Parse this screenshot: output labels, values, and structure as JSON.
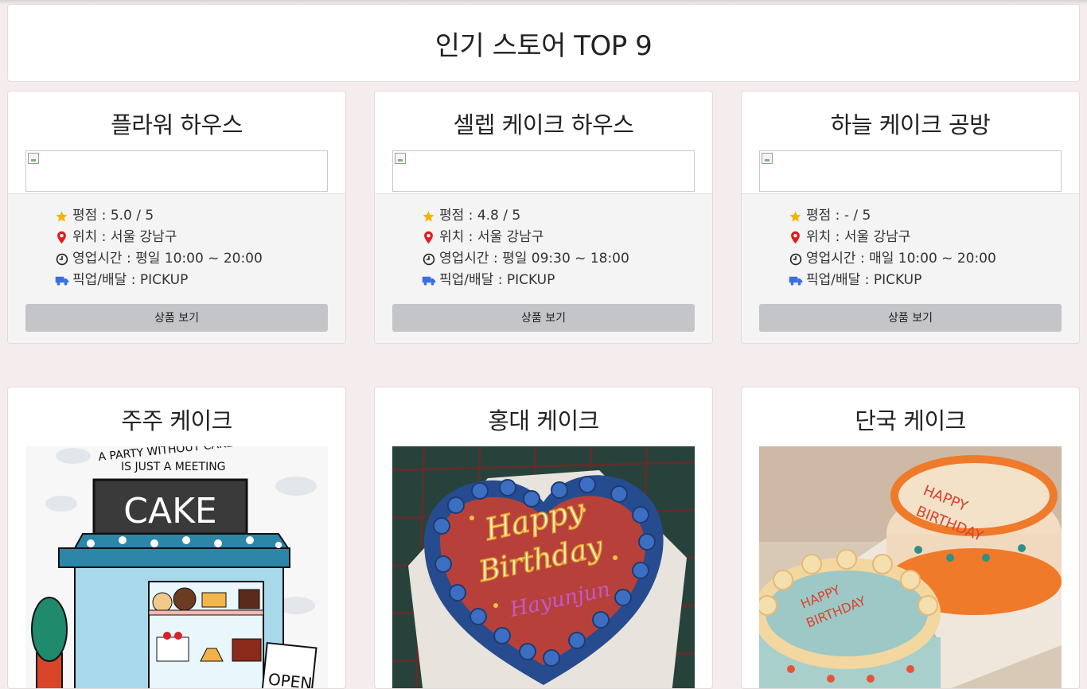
{
  "header": {
    "title": "인기 스토어 TOP 9"
  },
  "labels": {
    "rating_prefix": "평점 : ",
    "location_prefix": "위치 : ",
    "hours_prefix": "영업시간 : ",
    "pickup_prefix": "픽업/배달 : "
  },
  "colors": {
    "star": "#f5b301",
    "pin": "#e11d1d",
    "truck": "#3b6fe0",
    "button": "#c4c5c8"
  },
  "icons": [
    "star-icon",
    "map-pin-icon",
    "clock-icon",
    "truck-icon"
  ],
  "stores": [
    {
      "name": "플라워 하우스",
      "rating": "평점 : 5.0 / 5",
      "location": "위치 : 서울 강남구",
      "hours": "영업시간 : 평일 10:00 ~ 20:00",
      "pickup": "픽업/배달 : PICKUP",
      "button": "상품 보기"
    },
    {
      "name": "셀렙 케이크 하우스",
      "rating": "평점 : 4.8 / 5",
      "location": "위치 : 서울 강남구",
      "hours": "영업시간 : 평일 09:30 ~ 18:00",
      "pickup": "픽업/배달 : PICKUP",
      "button": "상품 보기"
    },
    {
      "name": "하늘 케이크 공방",
      "rating": "평점 : - / 5",
      "location": "위치 : 서울 강남구",
      "hours": "영업시간 : 매일 10:00 ~ 20:00",
      "pickup": "픽업/배달 : PICKUP",
      "button": "상품 보기"
    },
    {
      "name": "주주 케이크",
      "image_text": [
        "A PARTY WITHOUT CAKE",
        "IS JUST A MEETING",
        "CAKE",
        "OPEN"
      ]
    },
    {
      "name": "홍대 케이크",
      "image_text": [
        "Happy",
        "Birthday",
        "Hayunjun"
      ]
    },
    {
      "name": "단국 케이크",
      "image_text": [
        "HAPPY",
        "BIRTHDAY"
      ]
    }
  ]
}
